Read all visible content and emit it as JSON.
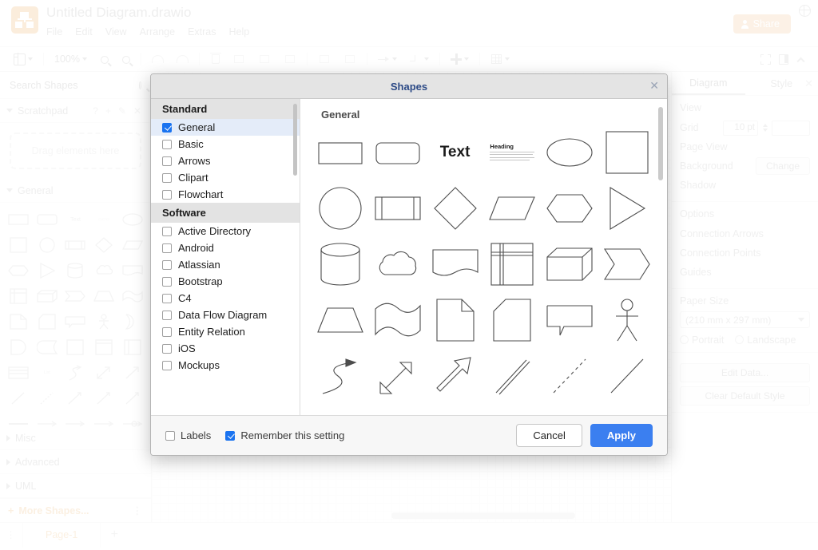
{
  "app": {
    "doc_title": "Untitled Diagram.drawio",
    "menus": [
      "File",
      "Edit",
      "View",
      "Arrange",
      "Extras",
      "Help"
    ],
    "share_label": "Share",
    "globe_icon": "globe-icon"
  },
  "toolbar": {
    "zoom_level": "100%",
    "items": [
      "view-panel-toggle",
      "zoom-dropdown",
      "zoom-out",
      "zoom-in",
      "undo",
      "redo",
      "delete",
      "fill-color",
      "line-color",
      "shape-style",
      "waypoints",
      "edge-style",
      "insert",
      "table"
    ],
    "right_items": [
      "fullscreen-icon",
      "format-panel-icon",
      "collapse-icon"
    ]
  },
  "left_panel": {
    "search_placeholder": "Search Shapes",
    "search_value": "",
    "scratchpad": {
      "title": "Scratchpad",
      "dropzone": "Drag elements here",
      "tools": [
        "help-icon",
        "add-icon",
        "edit-icon",
        "close-icon"
      ]
    },
    "sections": [
      {
        "title": "General",
        "expanded": true
      },
      {
        "title": "Misc",
        "expanded": false
      },
      {
        "title": "Advanced",
        "expanded": false
      },
      {
        "title": "UML",
        "expanded": false
      }
    ],
    "more_shapes": "More Shapes..."
  },
  "right_panel": {
    "tabs": [
      "Diagram",
      "Style"
    ],
    "active_tab": "Diagram",
    "view": {
      "title": "View",
      "grid_label": "Grid",
      "grid_value": "10 pt",
      "page_view_label": "Page View",
      "background_label": "Background",
      "change_label": "Change",
      "shadow_label": "Shadow"
    },
    "options": {
      "title": "Options",
      "rows": [
        "Connection Arrows",
        "Connection Points",
        "Guides"
      ]
    },
    "paper": {
      "title": "Paper Size",
      "selected": "(210 mm x 297 mm)",
      "portrait": "Portrait",
      "landscape": "Landscape"
    },
    "buttons": [
      "Edit Data...",
      "Clear Default Style"
    ]
  },
  "footer": {
    "page_tab": "Page-1",
    "add_page": "+",
    "menu_dots": "⋮"
  },
  "dialog": {
    "title": "Shapes",
    "close_icon": "close-icon",
    "preview_title": "General",
    "groups": [
      {
        "name": "Standard",
        "items": [
          {
            "label": "General",
            "checked": true,
            "selected": true
          },
          {
            "label": "Basic",
            "checked": false,
            "selected": false
          },
          {
            "label": "Arrows",
            "checked": false,
            "selected": false
          },
          {
            "label": "Clipart",
            "checked": false,
            "selected": false
          },
          {
            "label": "Flowchart",
            "checked": false,
            "selected": false
          }
        ]
      },
      {
        "name": "Software",
        "items": [
          {
            "label": "Active Directory",
            "checked": false,
            "selected": false
          },
          {
            "label": "Android",
            "checked": false,
            "selected": false
          },
          {
            "label": "Atlassian",
            "checked": false,
            "selected": false
          },
          {
            "label": "Bootstrap",
            "checked": false,
            "selected": false
          },
          {
            "label": "C4",
            "checked": false,
            "selected": false
          },
          {
            "label": "Data Flow Diagram",
            "checked": false,
            "selected": false
          },
          {
            "label": "Entity Relation",
            "checked": false,
            "selected": false
          },
          {
            "label": "iOS",
            "checked": false,
            "selected": false
          },
          {
            "label": "Mockups",
            "checked": false,
            "selected": false
          }
        ]
      }
    ],
    "preview_shapes": [
      "rectangle",
      "rounded-rectangle",
      "text",
      "textbox-heading",
      "ellipse",
      "square",
      "circle",
      "process",
      "diamond",
      "parallelogram",
      "hexagon",
      "triangle",
      "cylinder",
      "cloud",
      "document",
      "internal-storage",
      "cube",
      "step",
      "trapezoid",
      "tape",
      "note",
      "card",
      "callout",
      "actor",
      "curved-arrow",
      "bidirectional-arrow",
      "arrow",
      "double-line",
      "dashed-line",
      "line"
    ],
    "preview_text_sample": "Text",
    "preview_heading": "Heading",
    "footer": {
      "labels_label": "Labels",
      "labels_checked": false,
      "remember_label": "Remember this setting",
      "remember_checked": true,
      "cancel_label": "Cancel",
      "apply_label": "Apply"
    }
  },
  "colors": {
    "accent_blue": "#3b7ff0",
    "title_blue": "#2c4a86",
    "brand_orange": "#f0992e",
    "selection_blue": "#e4ecf9"
  }
}
